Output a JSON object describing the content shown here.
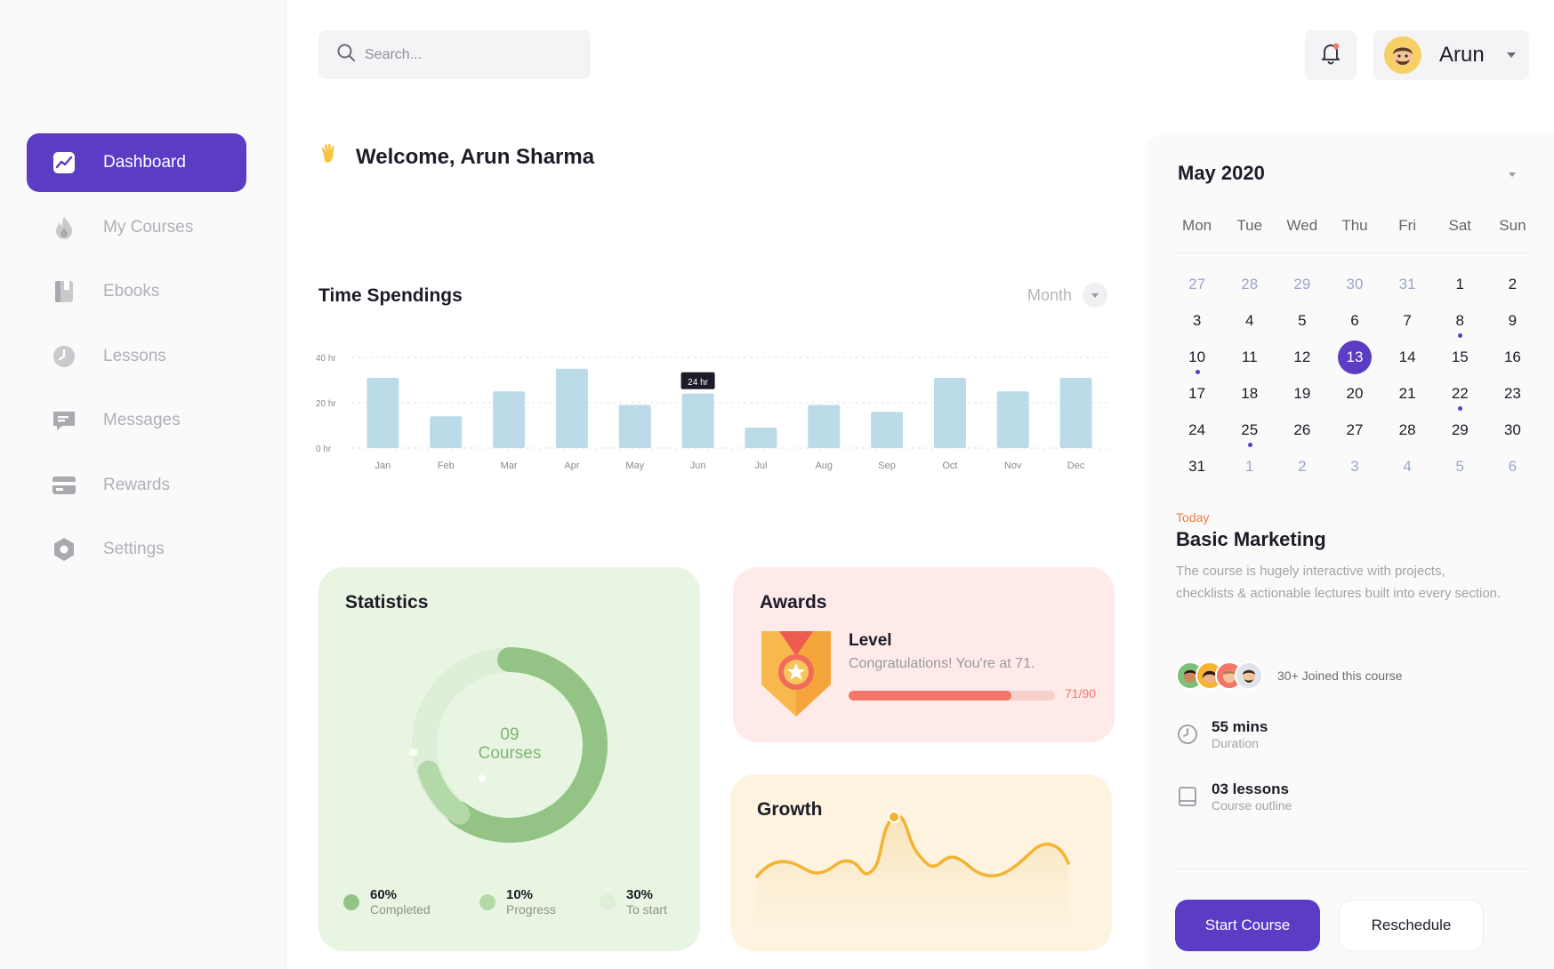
{
  "search": {
    "placeholder": "Search..."
  },
  "header": {
    "user_name": "Arun"
  },
  "nav": [
    {
      "label": "Dashboard",
      "icon": "chart-line-icon",
      "active": true
    },
    {
      "label": "My Courses",
      "icon": "flame-icon",
      "active": false
    },
    {
      "label": "Ebooks",
      "icon": "book-icon",
      "active": false
    },
    {
      "label": "Lessons",
      "icon": "clock-icon",
      "active": false
    },
    {
      "label": "Messages",
      "icon": "message-icon",
      "active": false
    },
    {
      "label": "Rewards",
      "icon": "card-icon",
      "active": false
    },
    {
      "label": "Settings",
      "icon": "gear-icon",
      "active": false
    }
  ],
  "welcome": {
    "text": "Welcome, Arun Sharma"
  },
  "time_spendings": {
    "title": "Time Spendings",
    "filter_label": "Month",
    "tooltip": "24 hr"
  },
  "chart_data": {
    "type": "bar",
    "categories": [
      "Jan",
      "Feb",
      "Mar",
      "Apr",
      "May",
      "Jun",
      "Jul",
      "Aug",
      "Sep",
      "Oct",
      "Nov",
      "Dec"
    ],
    "values": [
      31,
      14,
      25,
      35,
      19,
      24,
      9,
      19,
      16,
      31,
      25,
      31
    ],
    "ylim": [
      0,
      40
    ],
    "yticks": [
      "0 hr",
      "20 hr",
      "40 hr"
    ],
    "highlight_index": 5,
    "bar_color": "#bcdbe8",
    "grid": true
  },
  "statistics": {
    "title": "Statistics",
    "center_value": "09",
    "center_label": "Courses",
    "segments": [
      {
        "pct_value": 60,
        "pct": "60%",
        "label": "Completed",
        "color": "#93c486"
      },
      {
        "pct_value": 10,
        "pct": "10%",
        "label": "Progress",
        "color": "#b4d9a8"
      },
      {
        "pct_value": 30,
        "pct": "30%",
        "label": "To start",
        "color": "#ddefd6"
      }
    ]
  },
  "awards": {
    "title": "Awards",
    "level_label": "Level",
    "message": "Congratulations! You're at 71.",
    "score": "71/90",
    "progress_value": 71,
    "progress_max": 90
  },
  "growth": {
    "title": "Growth"
  },
  "calendar": {
    "title": "May 2020",
    "weekdays": [
      "Mon",
      "Tue",
      "Wed",
      "Thu",
      "Fri",
      "Sat",
      "Sun"
    ],
    "days": [
      {
        "d": "27",
        "muted": true
      },
      {
        "d": "28",
        "muted": true
      },
      {
        "d": "29",
        "muted": true
      },
      {
        "d": "30",
        "muted": true
      },
      {
        "d": "31",
        "muted": true
      },
      {
        "d": "1"
      },
      {
        "d": "2"
      },
      {
        "d": "3"
      },
      {
        "d": "4"
      },
      {
        "d": "5"
      },
      {
        "d": "6"
      },
      {
        "d": "7"
      },
      {
        "d": "8",
        "event": true
      },
      {
        "d": "9"
      },
      {
        "d": "10",
        "event": true
      },
      {
        "d": "11"
      },
      {
        "d": "12"
      },
      {
        "d": "13",
        "today": true
      },
      {
        "d": "14"
      },
      {
        "d": "15"
      },
      {
        "d": "16"
      },
      {
        "d": "17"
      },
      {
        "d": "18"
      },
      {
        "d": "19"
      },
      {
        "d": "20"
      },
      {
        "d": "21"
      },
      {
        "d": "22",
        "event": true
      },
      {
        "d": "23"
      },
      {
        "d": "24"
      },
      {
        "d": "25",
        "event": true
      },
      {
        "d": "26"
      },
      {
        "d": "27"
      },
      {
        "d": "28"
      },
      {
        "d": "29"
      },
      {
        "d": "30"
      },
      {
        "d": "31"
      },
      {
        "d": "1",
        "muted": true
      },
      {
        "d": "2",
        "muted": true
      },
      {
        "d": "3",
        "muted": true
      },
      {
        "d": "4",
        "muted": true
      },
      {
        "d": "5",
        "muted": true
      },
      {
        "d": "6",
        "muted": true
      }
    ]
  },
  "course": {
    "today_label": "Today",
    "title": "Basic Marketing",
    "description": "The course is hugely interactive with projects, checklists & actionable lectures built into every section.",
    "joined_text": "30+ Joined this course",
    "duration_value": "55 mins",
    "duration_label": "Duration",
    "lessons_value": "03 lessons",
    "lessons_label": "Course outline",
    "start_button": "Start Course",
    "reschedule_button": "Reschedule"
  },
  "colors": {
    "accent": "#5b3cc4",
    "stats_bg": "#e9f5e3",
    "awards_bg": "#fdeae9",
    "growth_bg": "#fdf3df",
    "growth_line": "#f5b332",
    "today_label": "#f07a3c"
  }
}
